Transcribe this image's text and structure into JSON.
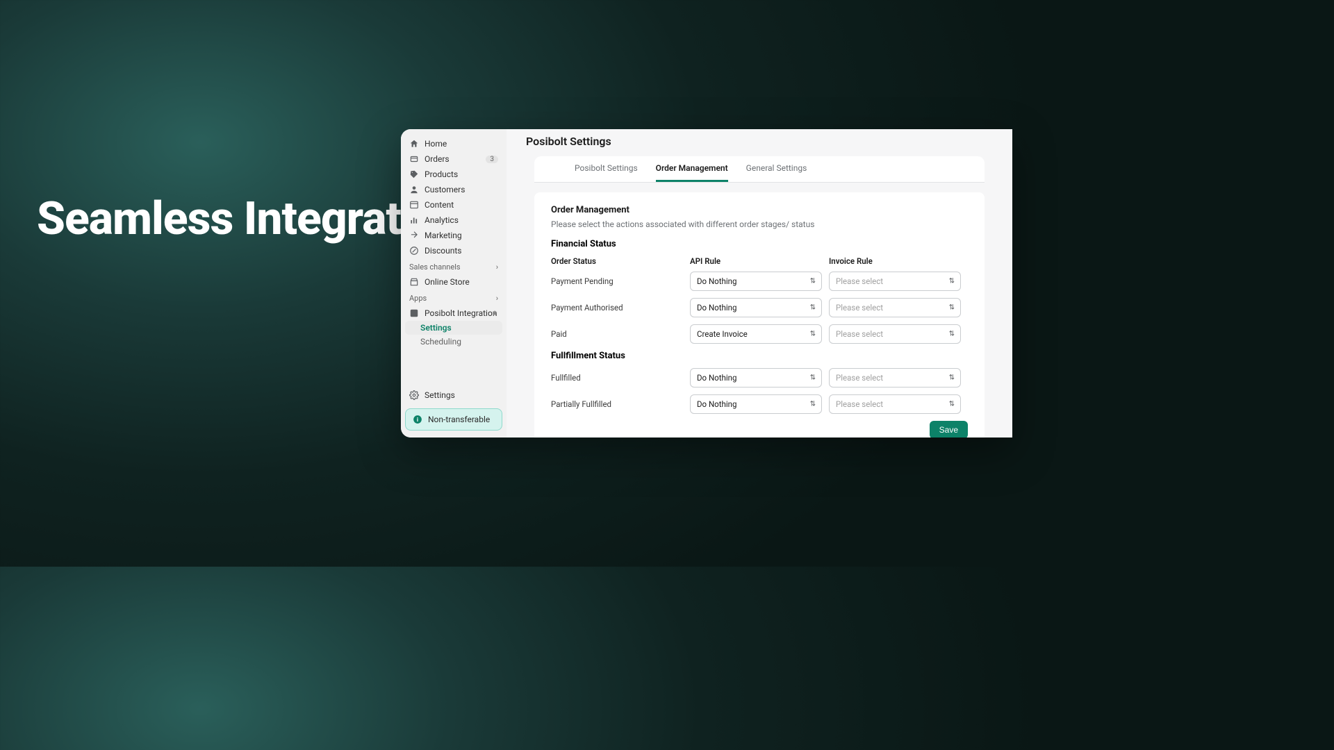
{
  "hero": "Seamless Integration with Shopify Apps",
  "sidebar": {
    "items": [
      {
        "label": "Home"
      },
      {
        "label": "Orders",
        "badge": "3"
      },
      {
        "label": "Products"
      },
      {
        "label": "Customers"
      },
      {
        "label": "Content"
      },
      {
        "label": "Analytics"
      },
      {
        "label": "Marketing"
      },
      {
        "label": "Discounts"
      }
    ],
    "channels_header": "Sales channels",
    "channels": [
      {
        "label": "Online Store"
      }
    ],
    "apps_header": "Apps",
    "app_item": "Posibolt Integration",
    "app_subs": [
      {
        "label": "Settings",
        "active": true
      },
      {
        "label": "Scheduling",
        "active": false
      }
    ],
    "settings_label": "Settings",
    "banner_text": "Non-transferable"
  },
  "page": {
    "title": "Posibolt Settings",
    "tabs": [
      {
        "label": "Posibolt Settings",
        "active": false
      },
      {
        "label": "Order Management",
        "active": true
      },
      {
        "label": "General Settings",
        "active": false
      }
    ],
    "section_title": "Order Management",
    "section_desc": "Please select the actions associated with different order stages/ status",
    "financial_heading": "Financial Status",
    "cols": {
      "order_status": "Order Status",
      "api_rule": "API Rule",
      "invoice_rule": "Invoice Rule"
    },
    "financial_rows": [
      {
        "label": "Payment Pending",
        "api": "Do Nothing",
        "invoice": "Please select",
        "invoice_placeholder": true
      },
      {
        "label": "Payment Authorised",
        "api": "Do Nothing",
        "invoice": "Please select",
        "invoice_placeholder": true
      },
      {
        "label": "Paid",
        "api": "Create Invoice",
        "invoice": "Please select",
        "invoice_placeholder": true
      }
    ],
    "fulfillment_heading": "Fullfillment Status",
    "fulfillment_rows": [
      {
        "label": "Fullfilled",
        "api": "Do Nothing",
        "invoice": "Please select",
        "invoice_placeholder": true
      },
      {
        "label": "Partially Fullfilled",
        "api": "Do Nothing",
        "invoice": "Please select",
        "invoice_placeholder": true
      }
    ],
    "save_label": "Save"
  }
}
